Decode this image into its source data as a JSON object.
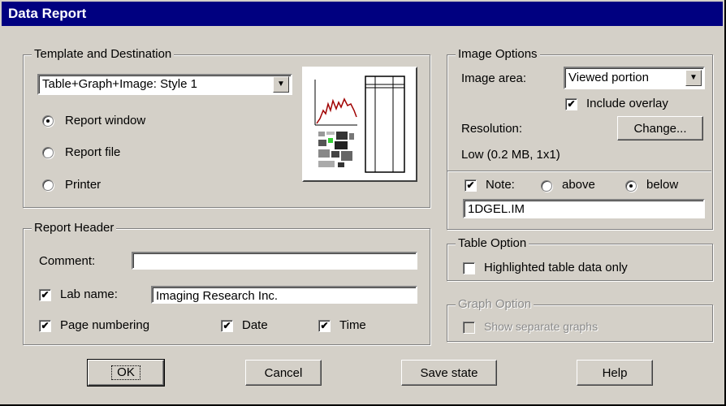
{
  "window": {
    "title": "Data Report"
  },
  "template": {
    "group_title": "Template and Destination",
    "selected_template": "Table+Graph+Image: Style 1",
    "destinations": [
      {
        "label": "Report window",
        "selected": true
      },
      {
        "label": "Report file",
        "selected": false
      },
      {
        "label": "Printer",
        "selected": false
      }
    ]
  },
  "header": {
    "group_title": "Report Header",
    "comment_label": "Comment:",
    "comment_value": "",
    "labname_label": "Lab name:",
    "labname_checked": true,
    "labname_value": "Imaging Research Inc.",
    "page_numbering_label": "Page numbering",
    "date_label": "Date",
    "time_label": "Time"
  },
  "image_options": {
    "group_title": "Image Options",
    "area_label": "Image area:",
    "area_value": "Viewed portion",
    "include_overlay_label": "Include overlay",
    "resolution_label": "Resolution:",
    "change_button": "Change...",
    "resolution_value": "Low (0.2 MB, 1x1)",
    "note_label": "Note:",
    "above_label": "above",
    "below_label": "below",
    "note_value": "1DGEL.IM"
  },
  "table_option": {
    "group_title": "Table Option",
    "highlighted_label": "Highlighted table data only"
  },
  "graph_option": {
    "group_title": "Graph Option",
    "separate_label": "Show separate graphs"
  },
  "buttons": {
    "ok": "OK",
    "cancel": "Cancel",
    "save_state": "Save state",
    "help": "Help"
  },
  "icons": {
    "dropdown": "chevron-down-icon",
    "check": "checkmark-icon",
    "preview": "report-layout-preview-icon"
  },
  "colors": {
    "titlebar": "#000080",
    "face": "#d4d0c8",
    "graph_line": "#a00000"
  }
}
